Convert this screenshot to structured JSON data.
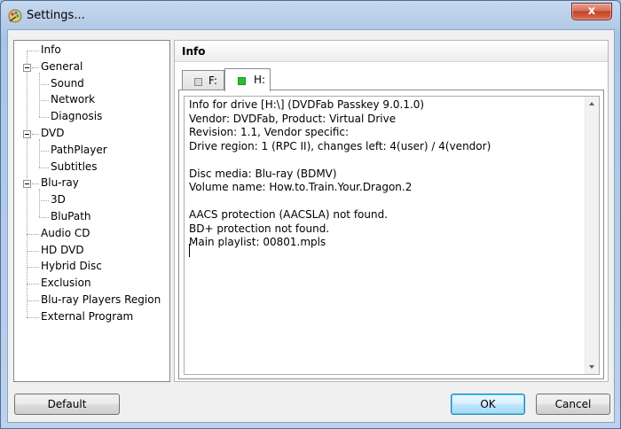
{
  "window": {
    "title": "Settings...",
    "close_symbol": "x"
  },
  "sidebar": {
    "items": [
      {
        "label": "Info",
        "level": 0,
        "expandable": false
      },
      {
        "label": "General",
        "level": 0,
        "expandable": true
      },
      {
        "label": "Sound",
        "level": 1,
        "expandable": false
      },
      {
        "label": "Network",
        "level": 1,
        "expandable": false
      },
      {
        "label": "Diagnosis",
        "level": 1,
        "expandable": false
      },
      {
        "label": "DVD",
        "level": 0,
        "expandable": true
      },
      {
        "label": "PathPlayer",
        "level": 1,
        "expandable": false
      },
      {
        "label": "Subtitles",
        "level": 1,
        "expandable": false
      },
      {
        "label": "Blu-ray",
        "level": 0,
        "expandable": true
      },
      {
        "label": "3D",
        "level": 1,
        "expandable": false
      },
      {
        "label": "BluPath",
        "level": 1,
        "expandable": false
      },
      {
        "label": "Audio CD",
        "level": 0,
        "expandable": false
      },
      {
        "label": "HD DVD",
        "level": 0,
        "expandable": false
      },
      {
        "label": "Hybrid Disc",
        "level": 0,
        "expandable": false
      },
      {
        "label": "Exclusion",
        "level": 0,
        "expandable": false
      },
      {
        "label": "Blu-ray Players Region",
        "level": 0,
        "expandable": false
      },
      {
        "label": "External Program",
        "level": 0,
        "expandable": false
      }
    ]
  },
  "panel": {
    "title": "Info",
    "tabs": [
      {
        "label": "F:",
        "active": false,
        "indicator_color": "#d8d8d8"
      },
      {
        "label": "H:",
        "active": true,
        "indicator_color": "#22c322"
      }
    ],
    "info_lines": [
      "Info for drive [H:\\] (DVDFab Passkey 9.0.1.0)",
      "Vendor: DVDFab, Product: Virtual Drive",
      "Revision: 1.1, Vendor specific:",
      "Drive region: 1 (RPC II), changes left: 4(user) / 4(vendor)",
      "",
      "Disc media: Blu-ray (BDMV)",
      "Volume name: How.to.Train.Your.Dragon.2",
      "",
      "AACS protection (AACSLA) not found.",
      "BD+ protection not found.",
      "Main playlist: 00801.mpls"
    ]
  },
  "footer": {
    "default_label": "Default",
    "ok_label": "OK",
    "cancel_label": "Cancel"
  },
  "colors": {
    "close_button": "#c44024",
    "focus_border": "#3c7fb1",
    "active_indicator": "#22c322"
  }
}
